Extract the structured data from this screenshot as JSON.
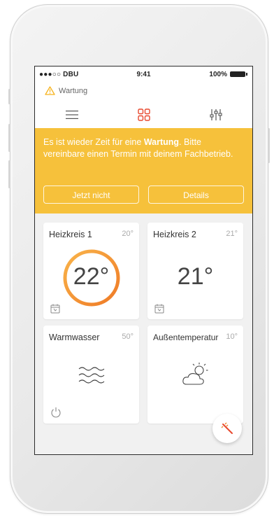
{
  "status_bar": {
    "carrier": "●●●○○ DBU",
    "time": "9:41",
    "battery": "100%"
  },
  "notification": {
    "label": "Wartung"
  },
  "nav": {
    "menu_icon": "menu-icon",
    "dashboard_icon": "grid-icon",
    "settings_icon": "sliders-icon"
  },
  "banner": {
    "message_pre": "Es ist wieder Zeit für eine ",
    "message_bold": "Wartung",
    "message_post": ". Bitte vereinbare einen Termin mit deinem Fachbetrieb.",
    "dismiss_label": "Jetzt nicht",
    "details_label": "Details"
  },
  "tiles": [
    {
      "title": "Heizkreis 1",
      "temp": "20°",
      "value": "22°",
      "icon": "calendar-icon"
    },
    {
      "title": "Heizkreis 2",
      "temp": "21°",
      "value": "21°",
      "icon": "calendar-icon"
    },
    {
      "title": "Warmwasser",
      "temp": "50°",
      "icon": "water-waves-icon",
      "footer_icon": "power-icon"
    },
    {
      "title": "Außentemperatur",
      "temp": "10°",
      "icon": "partly-cloudy-icon"
    }
  ],
  "colors": {
    "banner": "#f6c13b",
    "accent_orange": "#f08a2b",
    "accent_red": "#e8492f"
  }
}
